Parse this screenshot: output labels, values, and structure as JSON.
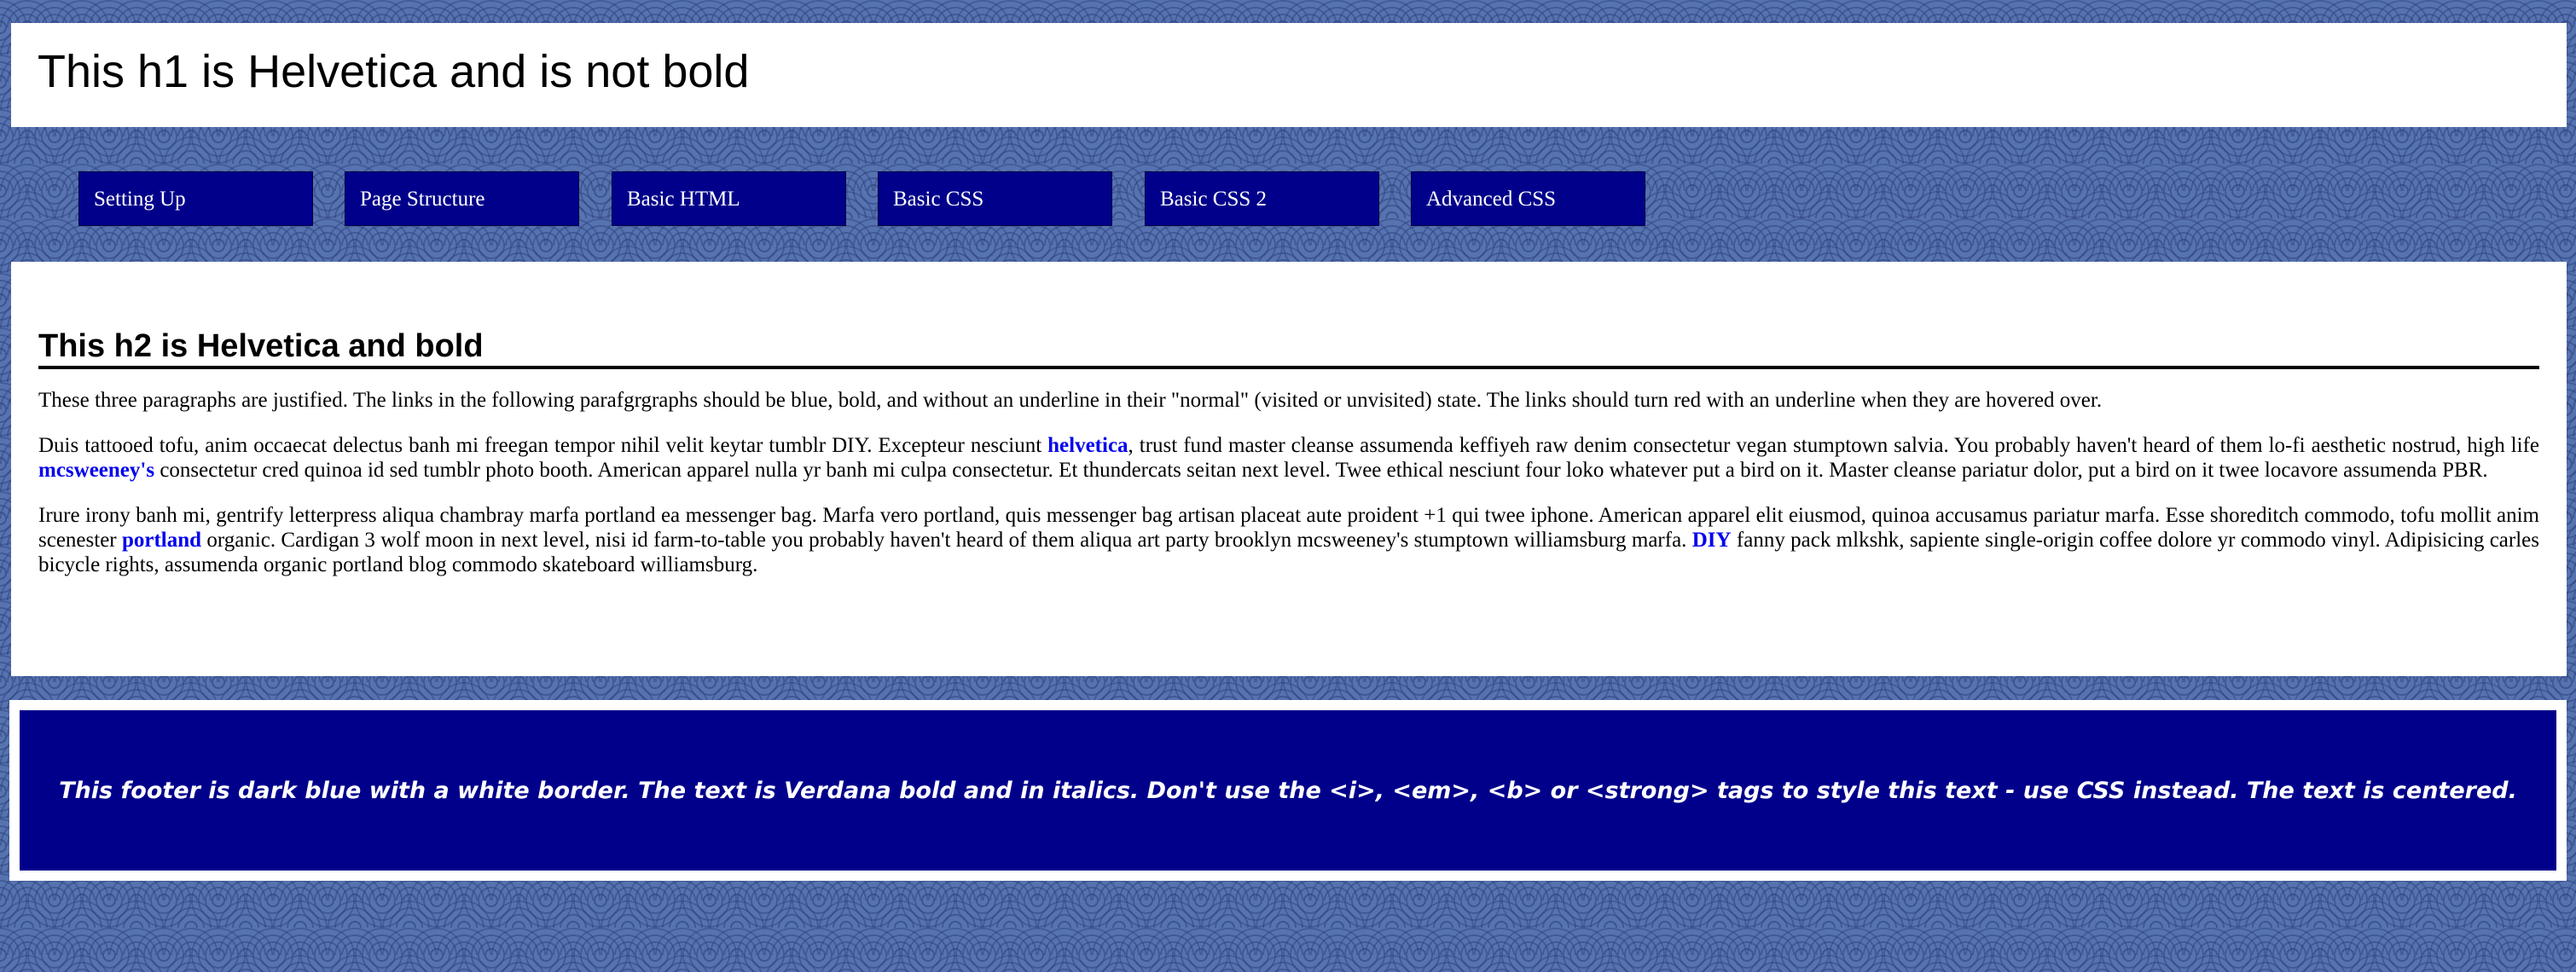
{
  "header": {
    "title": "This h1 is Helvetica and is not bold"
  },
  "nav": {
    "items": [
      {
        "label": "Setting Up"
      },
      {
        "label": "Page Structure"
      },
      {
        "label": "Basic HTML"
      },
      {
        "label": "Basic CSS"
      },
      {
        "label": "Basic CSS 2"
      },
      {
        "label": "Advanced CSS"
      }
    ]
  },
  "main": {
    "heading": "This h2 is Helvetica and bold",
    "p1": {
      "text": "These three paragraphs are justified. The links in the following parafgrgraphs should be blue, bold, and without an underline in their \"normal\" (visited or unvisited) state. The links should turn red with an underline when they are hovered over."
    },
    "p2": {
      "t1": "Duis tattooed tofu, anim occaecat delectus banh mi freegan tempor nihil velit keytar tumblr DIY. Excepteur nesciunt ",
      "link1": "helvetica",
      "t2": ", trust fund master cleanse assumenda keffiyeh raw denim consectetur vegan stumptown salvia. You probably haven't heard of them lo-fi aesthetic nostrud, high life ",
      "link2": "mcsweeney's",
      "t3": " consectetur cred quinoa id sed tumblr photo booth. American apparel nulla yr banh mi culpa consectetur. Et thundercats seitan next level. Twee ethical nesciunt four loko whatever put a bird on it. Master cleanse pariatur dolor, put a bird on it twee locavore assumenda PBR."
    },
    "p3": {
      "t1": "Irure irony banh mi, gentrify letterpress aliqua chambray marfa portland ea messenger bag. Marfa vero portland, quis messenger bag artisan placeat aute proident +1 qui twee iphone. American apparel elit eiusmod, quinoa accusamus pariatur marfa. Esse shoreditch commodo, tofu mollit anim scenester ",
      "link1": "portland",
      "t2": " organic. Cardigan 3 wolf moon in next level, nisi id farm-to-table you probably haven't heard of them aliqua art party brooklyn mcsweeney's stumptown williamsburg marfa. ",
      "link2": "DIY",
      "t3": " fanny pack mlkshk, sapiente single-origin coffee dolore yr commodo vinyl. Adipisicing carles bicycle rights, assumenda organic portland blog commodo skateboard williamsburg."
    }
  },
  "footer": {
    "text": "This footer is dark blue with a white border. The text is Verdana bold and in italics. Don't use the <i>, <em>, <b> or <strong> tags to style this text - use CSS instead. The text is centered."
  },
  "colors": {
    "background": "#5673b0",
    "nav_bg": "#00008b",
    "footer_bg": "#00008b",
    "link": "#0000ee",
    "link_hover": "#ff0000"
  }
}
